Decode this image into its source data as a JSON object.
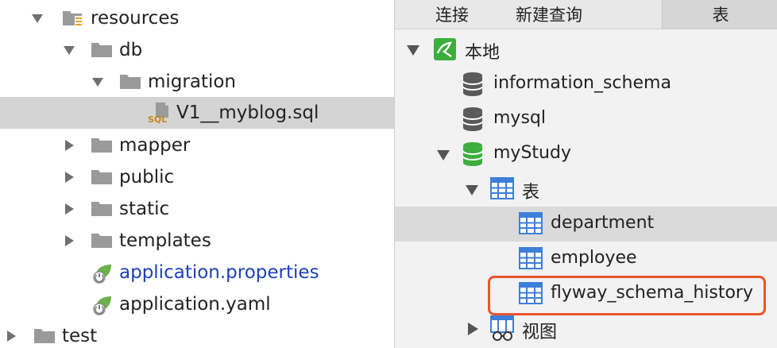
{
  "project_tree": {
    "items": [
      {
        "label": "resources",
        "type": "resources-folder",
        "state": "expanded"
      },
      {
        "label": "db",
        "type": "folder",
        "state": "expanded"
      },
      {
        "label": "migration",
        "type": "folder",
        "state": "expanded"
      },
      {
        "label": "V1__myblog.sql",
        "type": "sql-file",
        "state": "selected"
      },
      {
        "label": "mapper",
        "type": "folder",
        "state": "collapsed"
      },
      {
        "label": "public",
        "type": "folder",
        "state": "collapsed"
      },
      {
        "label": "static",
        "type": "folder",
        "state": "collapsed"
      },
      {
        "label": "templates",
        "type": "folder",
        "state": "collapsed"
      },
      {
        "label": "application.properties",
        "type": "spring-config",
        "state": "modified"
      },
      {
        "label": "application.yaml",
        "type": "spring-config",
        "state": "normal"
      },
      {
        "label": "test",
        "type": "folder",
        "state": "collapsed"
      }
    ],
    "file_badge": "SQL"
  },
  "db_navigator": {
    "tabs": [
      "连接",
      "新建查询",
      "表"
    ],
    "active_tab": "表",
    "tree": [
      {
        "label": "本地",
        "icon": "mysql-connection-icon"
      },
      {
        "label": "information_schema",
        "icon": "database-icon"
      },
      {
        "label": "mysql",
        "icon": "database-icon"
      },
      {
        "label": "myStudy",
        "icon": "database-open-icon"
      },
      {
        "label": "表",
        "icon": "tables-group-icon"
      },
      {
        "label": "department",
        "icon": "table-icon"
      },
      {
        "label": "employee",
        "icon": "table-icon"
      },
      {
        "label": "flyway_schema_history",
        "icon": "table-icon",
        "highlighted": true
      },
      {
        "label": "视图",
        "icon": "views-group-icon"
      }
    ]
  },
  "colors": {
    "highlight_border": "#e8552b",
    "modified_file_text": "#1e3fb8",
    "db_open_green": "#3cae3c",
    "table_blue": "#3d7fd9"
  }
}
